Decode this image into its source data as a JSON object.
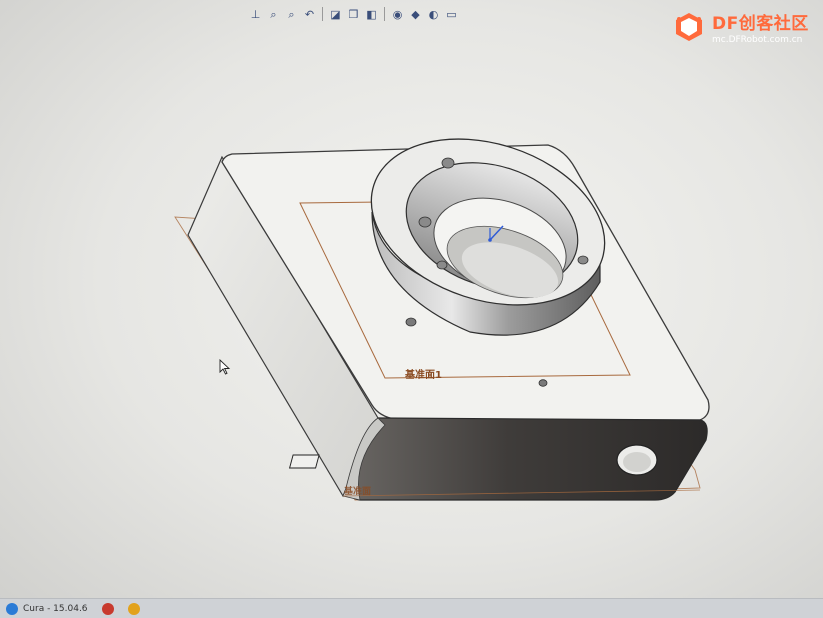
{
  "toolbar": {
    "buttons": [
      {
        "name": "view-orientation-icon",
        "glyph": "⊥"
      },
      {
        "name": "zoom-to-fit-icon",
        "glyph": "⌕"
      },
      {
        "name": "zoom-area-icon",
        "glyph": "⌕"
      },
      {
        "name": "previous-view-icon",
        "glyph": "↶"
      },
      {
        "name": "section-view-icon",
        "glyph": "◪"
      },
      {
        "name": "view-selector-icon",
        "glyph": "❒"
      },
      {
        "name": "display-style-icon",
        "glyph": "◧"
      },
      {
        "name": "hide-show-items-icon",
        "glyph": "◉"
      },
      {
        "name": "edit-appearance-icon",
        "glyph": "◆"
      },
      {
        "name": "apply-scene-icon",
        "glyph": "◐"
      },
      {
        "name": "view-settings-icon",
        "glyph": "▭"
      }
    ]
  },
  "watermark": {
    "brand": "DF创客社区",
    "url": "mc.DFRobot.com.cn"
  },
  "model": {
    "plane_label_top": "基准面1",
    "plane_label_bottom": "基准面"
  },
  "taskbar": {
    "items": [
      {
        "label": "Cura - 15.04.6",
        "color": "#2b7bd6"
      },
      {
        "label": "",
        "color": "#c83a2e"
      },
      {
        "label": "",
        "color": "#e2a21c"
      }
    ]
  },
  "colors": {
    "body_face": "#f2f2ef",
    "front_face": "#4a4745",
    "edge": "#3b3b3b",
    "plane": "#a86a3e",
    "accent_triad": "#2f5bd6"
  }
}
